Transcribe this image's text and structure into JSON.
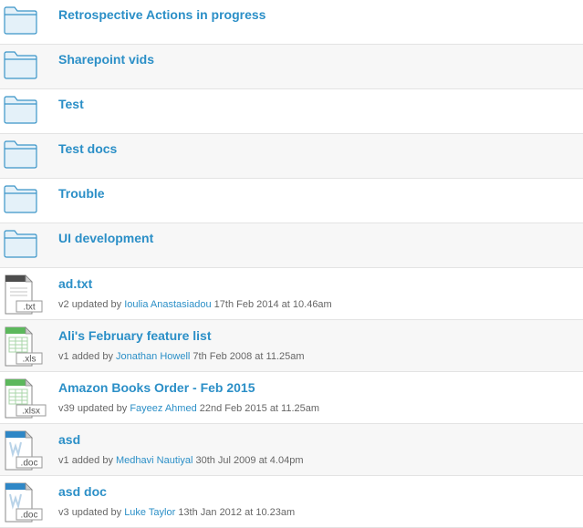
{
  "folders": [
    {
      "name": "Retrospective Actions in progress"
    },
    {
      "name": "Sharepoint vids"
    },
    {
      "name": "Test"
    },
    {
      "name": "Test docs"
    },
    {
      "name": "Trouble"
    },
    {
      "name": "UI development"
    }
  ],
  "files": [
    {
      "name": "ad.txt",
      "ext": ".txt",
      "icon": "txt-file-icon",
      "version": "v2",
      "action": "updated by",
      "user": "Ioulia Anastasiadou",
      "date": "17th Feb 2014 at 10.46am"
    },
    {
      "name": "Ali's February feature list",
      "ext": ".xls",
      "icon": "xls-file-icon",
      "version": "v1",
      "action": "added by",
      "user": "Jonathan Howell",
      "date": "7th Feb 2008 at 11.25am"
    },
    {
      "name": "Amazon Books Order - Feb 2015",
      "ext": ".xlsx",
      "icon": "xlsx-file-icon",
      "version": "v39",
      "action": "updated by",
      "user": "Fayeez Ahmed",
      "date": "22nd Feb 2015 at 11.25am"
    },
    {
      "name": "asd",
      "ext": ".doc",
      "icon": "doc-file-icon",
      "version": "v1",
      "action": "added by",
      "user": "Medhavi Nautiyal",
      "date": "30th Jul 2009 at 4.04pm"
    },
    {
      "name": "asd doc",
      "ext": ".doc",
      "icon": "doc-file-icon",
      "version": "v3",
      "action": "updated by",
      "user": "Luke Taylor",
      "date": "13th Jan 2012 at 10.23am"
    }
  ],
  "colors": {
    "link": "#2b8fc7",
    "folder_fill": "#e4f1f9",
    "folder_stroke": "#3b95c8",
    "txt_band": "#4d4d4d",
    "xls_band": "#5cb85c",
    "doc_band": "#2f87c6"
  }
}
